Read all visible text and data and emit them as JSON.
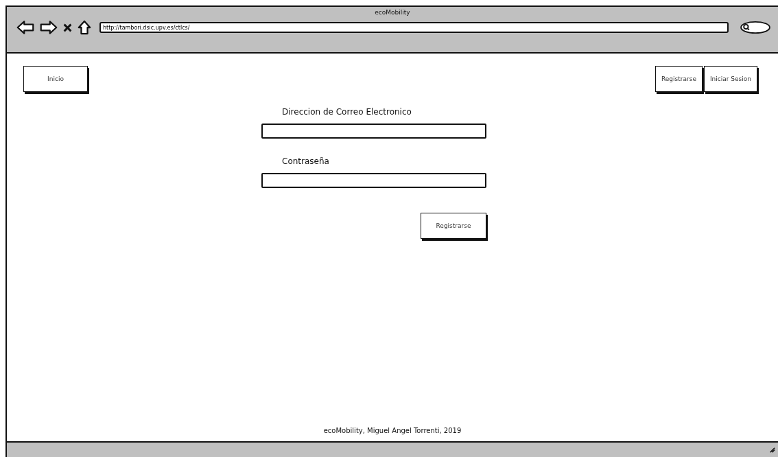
{
  "window": {
    "title": "ecoMobility"
  },
  "address_bar": {
    "value": "http://tambori.dsic.upv.es/ctlcs/"
  },
  "nav": {
    "left": [
      {
        "label": "Inicio"
      }
    ],
    "right": [
      {
        "label": "Registrarse"
      },
      {
        "label": "Iniciar Sesion"
      }
    ]
  },
  "form": {
    "fields": [
      {
        "label": "Direccion de Correo Electronico"
      },
      {
        "label": "Contraseña"
      }
    ],
    "submit": "Registrarse"
  },
  "footer": "ecoMobility, Miguel Angel Torrenti, 2019"
}
